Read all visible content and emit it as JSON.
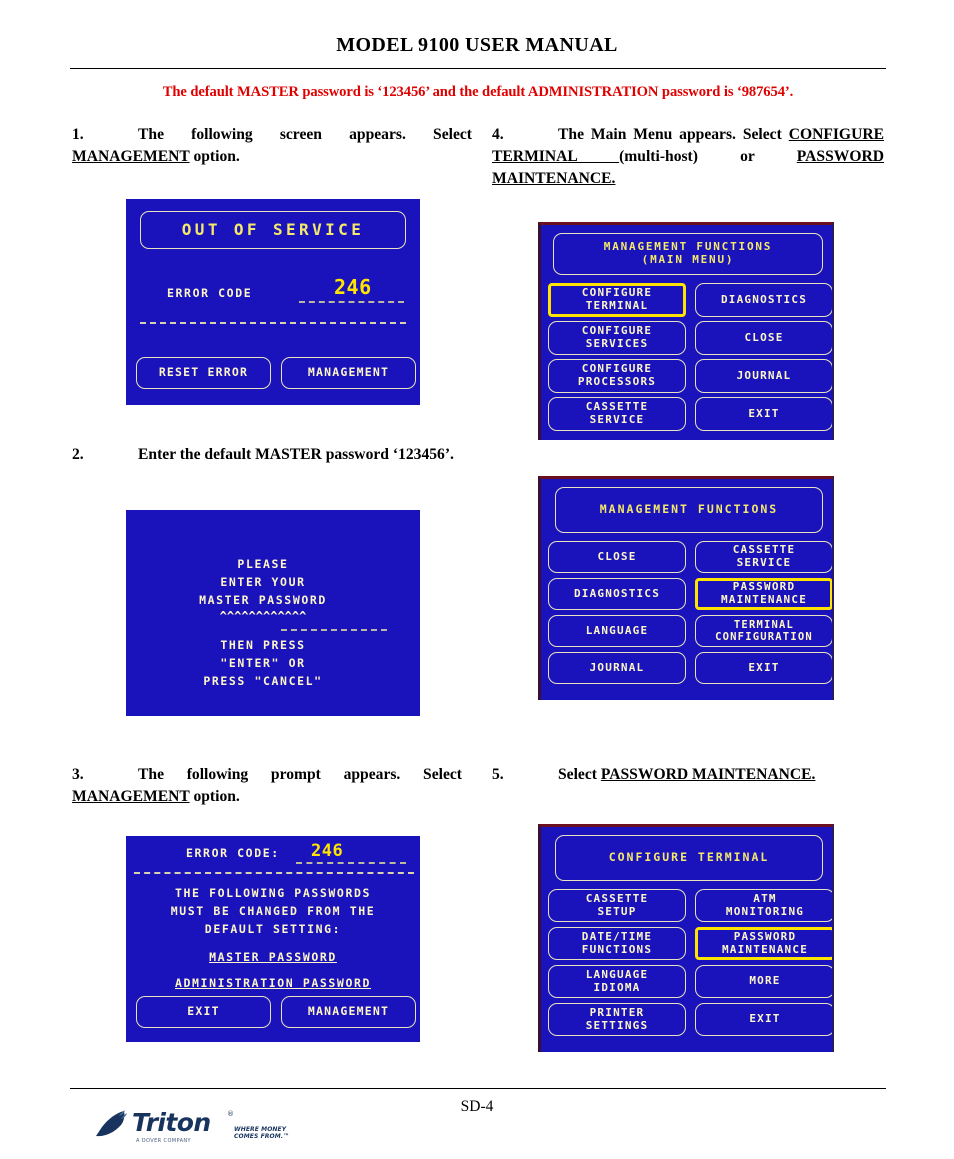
{
  "header": {
    "title_parts": [
      "M",
      "ODEL",
      " 9100 U",
      "SER",
      " M",
      "ANUAL"
    ],
    "title_plain": "MODEL 9100 USER MANUAL",
    "warning": "The default MASTER password is ‘123456’ and the default ADMINISTRATION password is ‘987654’."
  },
  "steps": {
    "s1": {
      "number": "1.",
      "text_a": "The following screen appears.  Select ",
      "text_underline": "MANAGEMENT",
      "text_b": " option."
    },
    "s2": {
      "number": "2.",
      "text_a": "Enter the default MASTER password ‘123456’."
    },
    "s3": {
      "number": "3.",
      "text_a": "The following prompt appears.  Select ",
      "text_underline": "MANAGEMENT",
      "text_b": " option."
    },
    "s4": {
      "number": "4.",
      "text_a": "The Main Menu appears.  Select ",
      "underline_1": "CONFIGURE  TERMINAL ",
      "text_b": "(multi-host)  or  ",
      "underline_2": "PASSWORD MAINTENANCE."
    },
    "s5": {
      "number": "5.",
      "text_a": "Select ",
      "underline_1": "PASSWORD MAINTENANCE."
    }
  },
  "screens": {
    "out_of_service": {
      "title": "OUT OF SERVICE",
      "error_label": "ERROR CODE",
      "error_value": "246",
      "buttons": [
        "RESET ERROR",
        "MANAGEMENT"
      ]
    },
    "enter_password": {
      "lines": [
        "PLEASE",
        "ENTER YOUR",
        "MASTER PASSWORD"
      ],
      "squiggle": "^^^^^^^^^^^^",
      "lines_after": [
        "THEN PRESS",
        "\"ENTER\" OR",
        "PRESS \"CANCEL\""
      ]
    },
    "error_prompt": {
      "error_label": "ERROR CODE:",
      "error_value": "246",
      "body": [
        "THE FOLLOWING PASSWORDS",
        "MUST BE CHANGED FROM THE",
        "DEFAULT SETTING:"
      ],
      "underlined": [
        "MASTER PASSWORD",
        "ADMINISTRATION PASSWORD"
      ],
      "buttons": [
        "EXIT",
        "MANAGEMENT"
      ]
    },
    "management_main": {
      "header": "MANAGEMENT FUNCTIONS\n(MAIN MENU)",
      "left_buttons": [
        "CONFIGURE\nTERMINAL",
        "CONFIGURE\nSERVICES",
        "CONFIGURE\nPROCESSORS",
        "CASSETTE\nSERVICE"
      ],
      "right_buttons": [
        "DIAGNOSTICS",
        "CLOSE",
        "JOURNAL",
        "EXIT"
      ],
      "selected": "CONFIGURE\nTERMINAL"
    },
    "management_functions": {
      "header": "MANAGEMENT FUNCTIONS",
      "left_buttons": [
        "CLOSE",
        "DIAGNOSTICS",
        "LANGUAGE",
        "JOURNAL"
      ],
      "right_buttons": [
        "CASSETTE\nSERVICE",
        "PASSWORD\nMAINTENANCE",
        "TERMINAL\nCONFIGURATION",
        "EXIT"
      ],
      "selected": "PASSWORD\nMAINTENANCE"
    },
    "configure_terminal": {
      "header": "CONFIGURE TERMINAL",
      "left_buttons": [
        "CASSETTE\nSETUP",
        "DATE/TIME\nFUNCTIONS",
        "LANGUAGE\nIDIOMA",
        "PRINTER\nSETTINGS"
      ],
      "right_buttons": [
        "ATM\nMONITORING",
        "PASSWORD\nMAINTENANCE",
        "MORE",
        "EXIT"
      ],
      "selected": "PASSWORD\nMAINTENANCE"
    }
  },
  "footer": {
    "page_number": "SD-4",
    "logo_word": "Triton",
    "logo_reg": "®",
    "logo_tagline": "WHERE MONEY COMES FROM.™",
    "logo_subtext": "A DOVER COMPANY"
  },
  "colors": {
    "screen_bg": "#1a13bb",
    "screen_text": "#fdf6c8",
    "screen_highlight": "#ffe400",
    "warning_red": "#e00000",
    "logo_navy": "#18345e"
  }
}
